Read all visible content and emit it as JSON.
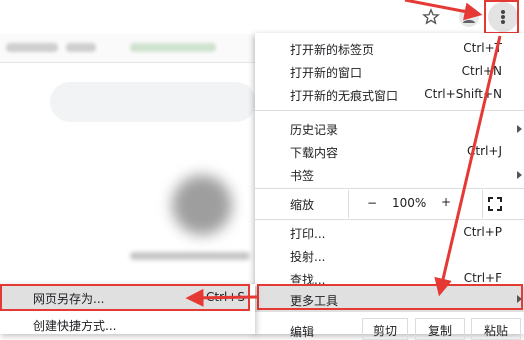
{
  "menu": {
    "items": [
      {
        "label": "打开新的标签页",
        "shortcut": "Ctrl+T"
      },
      {
        "label": "打开新的窗口",
        "shortcut": "Ctrl+N"
      },
      {
        "label": "打开新的无痕式窗口",
        "shortcut": "Ctrl+Shift+N"
      },
      {
        "label": "历史记录",
        "shortcut": ""
      },
      {
        "label": "下载内容",
        "shortcut": "Ctrl+J"
      },
      {
        "label": "书签",
        "shortcut": ""
      },
      {
        "label": "打印...",
        "shortcut": "Ctrl+P"
      },
      {
        "label": "投射...",
        "shortcut": ""
      },
      {
        "label": "查找...",
        "shortcut": "Ctrl+F"
      }
    ],
    "zoom": {
      "label": "缩放",
      "minus": "−",
      "value": "100%",
      "plus": "+"
    },
    "more_tools": "更多工具",
    "edit": {
      "label": "编辑",
      "cut": "剪切",
      "copy": "复制",
      "paste": "粘贴"
    }
  },
  "submenu": {
    "save_page_as": {
      "label": "网页另存为...",
      "shortcut": "Ctrl+S"
    },
    "create_shortcut": "创建快捷方式..."
  },
  "colors": {
    "annotation": "#e53935",
    "highlight": "#e0e0e0"
  },
  "icons": {
    "star": "star-icon",
    "profile": "profile-icon",
    "menu": "kebab-menu-icon",
    "fullscreen": "fullscreen-icon"
  }
}
